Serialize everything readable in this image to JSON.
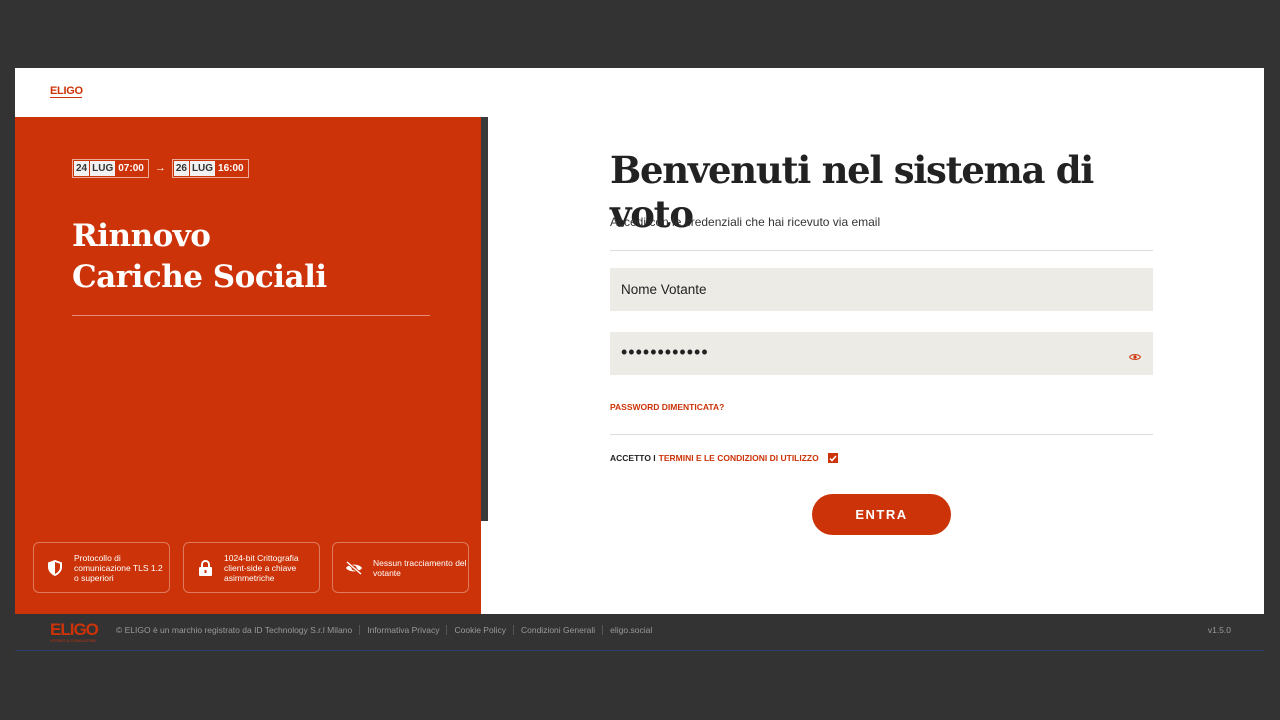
{
  "brand": {
    "logo_text": "ELIGO",
    "logo_sub": "VOTING & CONSULTING"
  },
  "left_panel": {
    "start": {
      "day": "24",
      "month": "LUG",
      "time": "07:00"
    },
    "end": {
      "day": "26",
      "month": "LUG",
      "time": "16:00"
    },
    "title_line1": "Rinnovo",
    "title_line2": "Cariche Sociali",
    "features": [
      {
        "icon": "shield-icon",
        "text": "Protocollo di comunicazione TLS 1.2 o superiori"
      },
      {
        "icon": "lock-icon",
        "text": "1024-bit Crittografia client-side a chiave asimmetriche"
      },
      {
        "icon": "eye-off-icon",
        "text": "Nessun tracciamento del votante"
      }
    ]
  },
  "form": {
    "heading": "Benvenuti nel sistema di voto",
    "subtitle": "Accedi con le credenziali che hai ricevuto via email",
    "username_value": "Nome Votante",
    "password_value": "••••••••••••",
    "forgot_label": "PASSWORD DIMENTICATA?",
    "accept_prefix": "ACCETTO I",
    "accept_link": "TERMINI E LE CONDIZIONI DI UTILIZZO",
    "accept_checked": true,
    "submit_label": "ENTRA"
  },
  "footer": {
    "copyright": "© ELIGO è un marchio registrato da ID Technology S.r.l Milano",
    "links": [
      "Informativa Privacy",
      "Cookie Policy",
      "Condizioni Generali",
      "eligo.social"
    ],
    "version": "v1.5.0"
  },
  "colors": {
    "accent": "#cc3308",
    "dark": "#333333",
    "input_bg": "#ecebe6"
  }
}
